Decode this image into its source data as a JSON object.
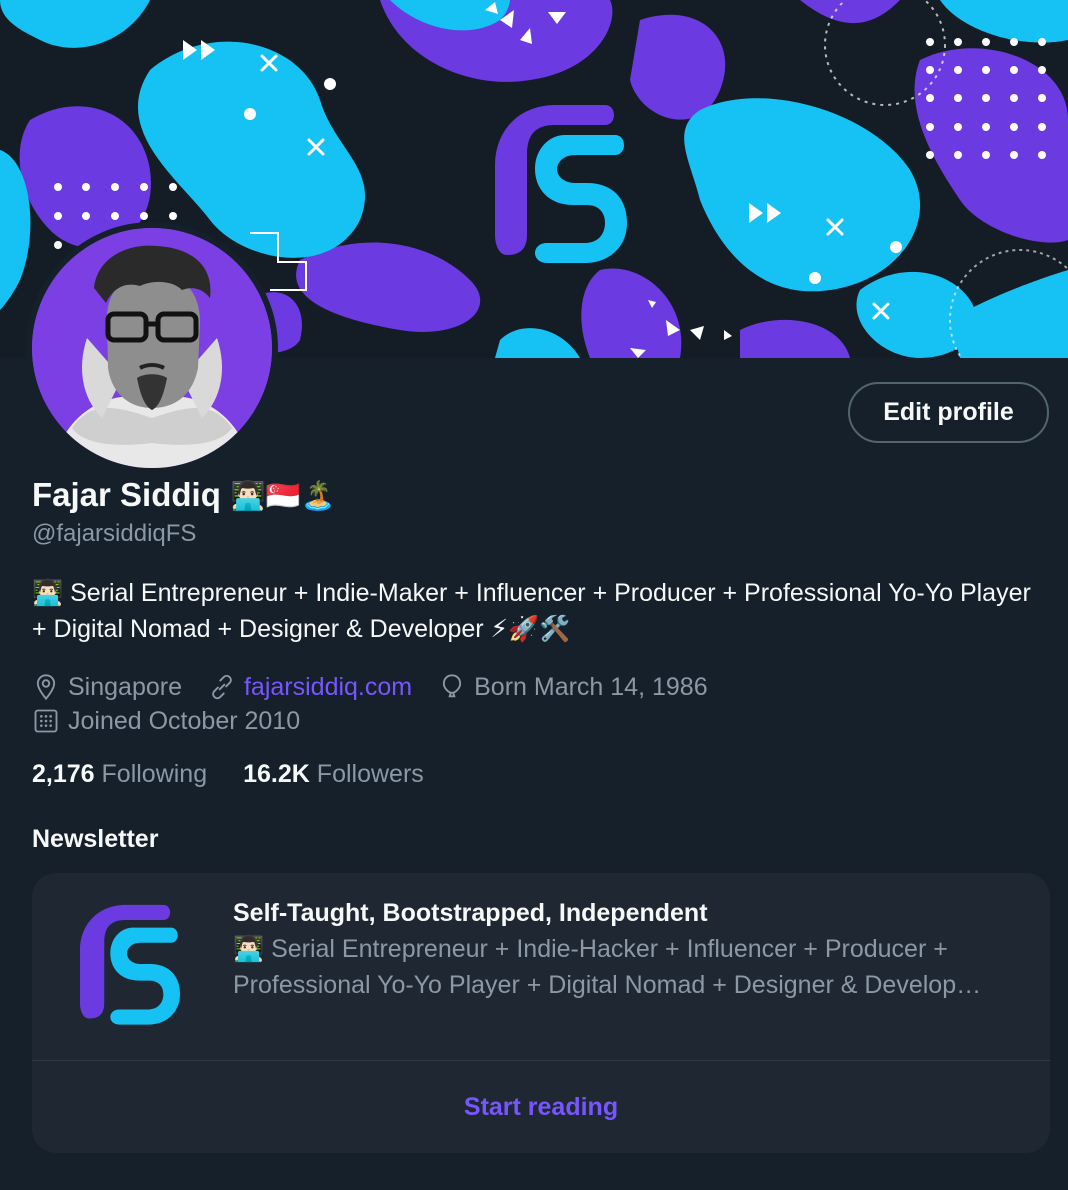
{
  "profile": {
    "name": "Fajar Siddiq",
    "name_emojis": "👨🏻‍💻🇸🇬🏝️",
    "handle": "@fajarsiddiqFS",
    "bio": "👨🏻‍💻 Serial Entrepreneur + Indie-Maker + Influencer + Producer + Professional Yo-Yo Player + Digital Nomad + Designer & Developer ⚡🚀🛠️",
    "location": "Singapore",
    "website": "fajarsiddiq.com",
    "birthday": "Born March 14, 1986",
    "joined": "Joined October 2010",
    "following_count": "2,176",
    "following_label": "Following",
    "followers_count": "16.2K",
    "followers_label": "Followers",
    "edit_label": "Edit profile"
  },
  "newsletter": {
    "section_title": "Newsletter",
    "title": "Self-Taught, Bootstrapped, Independent",
    "description": "👨🏻‍💻 Serial Entrepreneur + Indie-Hacker + Influencer + Producer + Professional Yo-Yo Player + Digital Nomad + Designer & Develop…",
    "cta": "Start reading"
  },
  "icons": {
    "location": "map-pin-icon",
    "website": "link-icon",
    "birthday": "balloon-icon",
    "joined": "calendar-icon"
  },
  "colors": {
    "background": "#15202b",
    "accent": "#7856ff",
    "banner_blue": "#16c1f3",
    "banner_purple": "#6b3ae0",
    "muted": "#8b98a5"
  }
}
